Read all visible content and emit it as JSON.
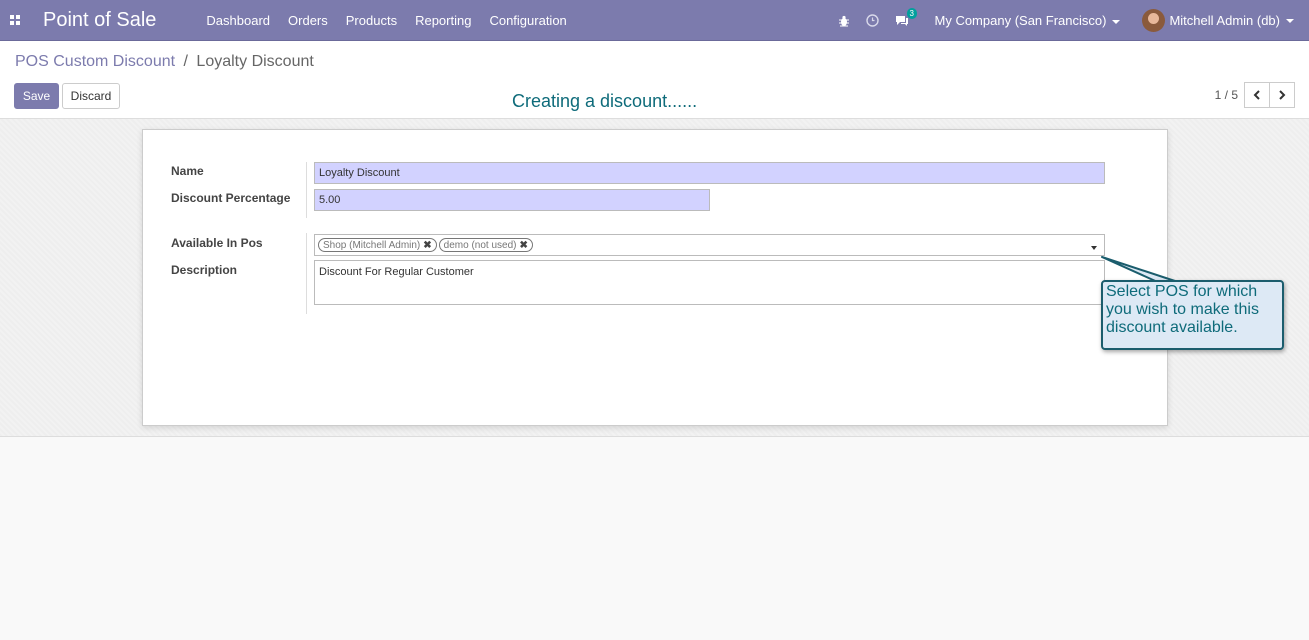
{
  "navbar": {
    "app_title": "Point of Sale",
    "menu": [
      "Dashboard",
      "Orders",
      "Products",
      "Reporting",
      "Configuration"
    ],
    "messages_count": "3",
    "company": "My Company (San Francisco)",
    "user": "Mitchell Admin (db)",
    "bg_color": "#7c7bad"
  },
  "breadcrumb": {
    "parent": "POS Custom Discount",
    "separator": "/",
    "current": "Loyalty Discount"
  },
  "toolbar": {
    "save_label": "Save",
    "discard_label": "Discard"
  },
  "tour": {
    "title": "Creating a discount......",
    "callout": "Select POS for which you wish to make this discount available."
  },
  "pager": {
    "value": "1 / 5"
  },
  "form": {
    "name_label": "Name",
    "name_value": "Loyalty Discount",
    "discount_label": "Discount Percentage",
    "discount_value": "5.00",
    "pos_label": "Available In Pos",
    "pos_tags": [
      "Shop (Mitchell Admin)",
      "demo (not used)"
    ],
    "description_label": "Description",
    "description_value": "Discount For Regular Customer"
  }
}
